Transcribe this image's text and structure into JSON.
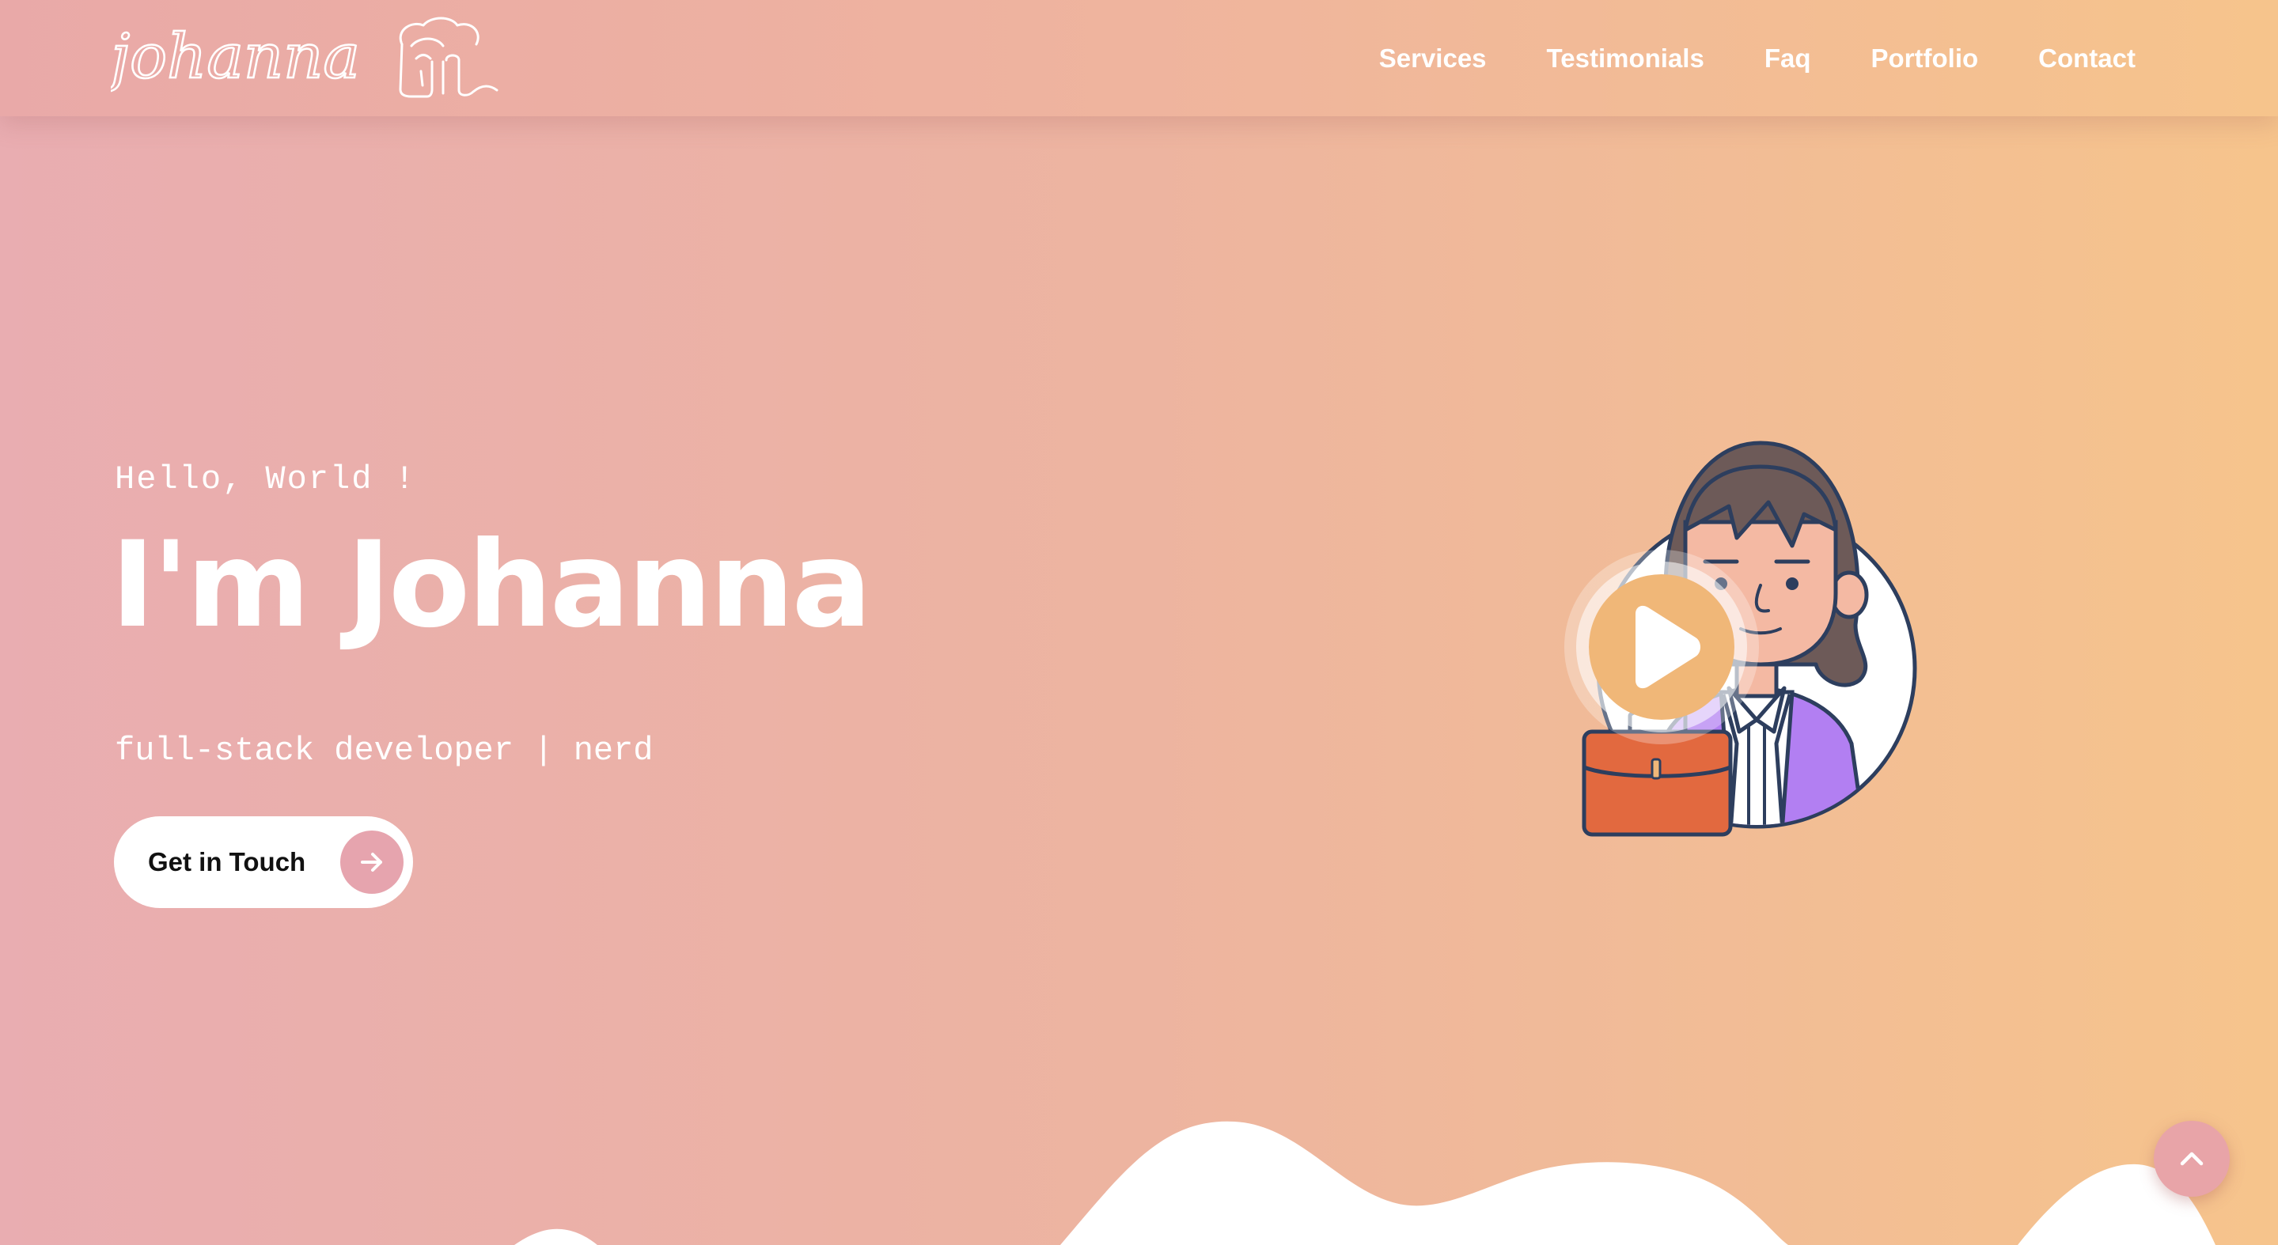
{
  "header": {
    "logo_text": "johanna",
    "nav": [
      {
        "label": "Services"
      },
      {
        "label": "Testimonials"
      },
      {
        "label": "Faq"
      },
      {
        "label": "Portfolio"
      },
      {
        "label": "Contact"
      }
    ]
  },
  "hero": {
    "greeting": "Hello, World !",
    "title": "I'm Johanna",
    "tagline": "full-stack developer | nerd",
    "cta_label": "Get in Touch",
    "cta_icon": "arrow-right-icon",
    "illustration_icon": "developer-avatar-illustration",
    "play_icon": "play-icon"
  },
  "footer": {
    "back_to_top_icon": "chevron-up-icon"
  },
  "colors": {
    "gradient_start": "#e9adb1",
    "gradient_end": "#f6c48c",
    "accent_pink": "#e6a4ae",
    "play_orange": "#f0b778",
    "bag_orange": "#e2693f",
    "jacket_purple": "#b27ff2",
    "hair_brown": "#6d5a58",
    "skin": "#f4b9a3",
    "outline": "#2d3e5e"
  }
}
